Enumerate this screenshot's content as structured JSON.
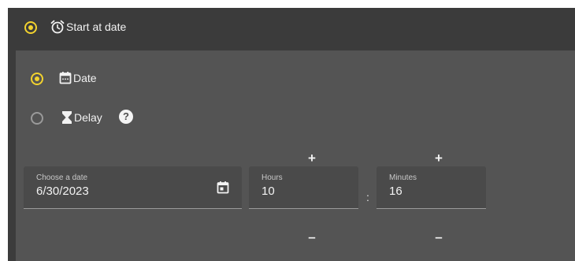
{
  "header": {
    "option_label": "Start at date",
    "icon": "alarm-clock-icon",
    "selected": true
  },
  "options": [
    {
      "label": "Date",
      "icon": "calendar-icon",
      "selected": true
    },
    {
      "label": "Delay",
      "icon": "hourglass-icon",
      "selected": false,
      "help": "?"
    }
  ],
  "date_field": {
    "label": "Choose a date",
    "value": "6/30/2023",
    "icon": "calendar-picker-icon"
  },
  "hours_field": {
    "label": "Hours",
    "value": "10",
    "increment": "+",
    "decrement": "–"
  },
  "time_separator": ":",
  "minutes_field": {
    "label": "Minutes",
    "value": "16",
    "increment": "+",
    "decrement": "–"
  },
  "colors": {
    "accent": "#f2d22e",
    "header_bg": "#3b3b3b",
    "panel_bg": "#545454",
    "field_bg": "#4a4a4a"
  }
}
